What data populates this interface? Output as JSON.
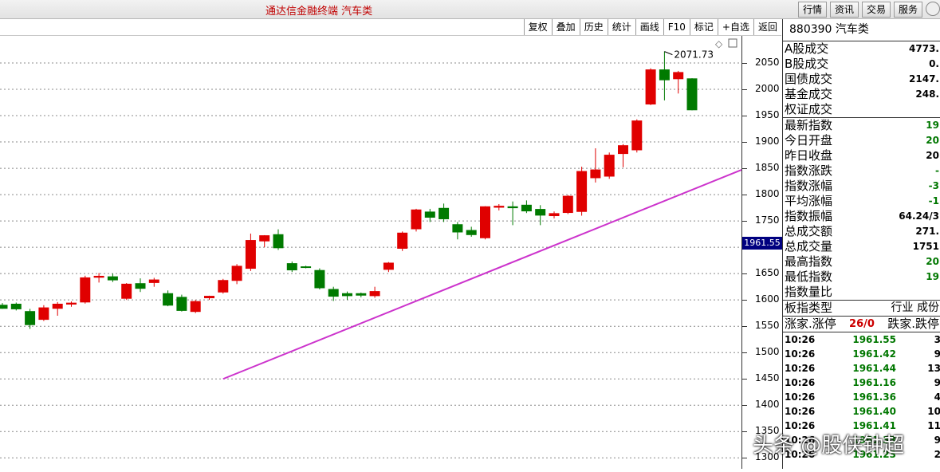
{
  "app": {
    "title": "通达信金融终端  汽车类"
  },
  "top_menu": [
    "行情",
    "资讯",
    "交易",
    "服务"
  ],
  "toolbar": [
    "复权",
    "叠加",
    "历史",
    "统计",
    "画线",
    "F10",
    "标记",
    "+自选",
    "返回"
  ],
  "chart_data": {
    "type": "candlestick",
    "ylim": [
      1300,
      2100
    ],
    "yticks": [
      1300,
      1350,
      1400,
      1450,
      1500,
      1550,
      1600,
      1650,
      1700,
      1750,
      1800,
      1850,
      1900,
      1950,
      2000,
      2050
    ],
    "ytick_labels": [
      "1300",
      "1350",
      "1400",
      "1450",
      "1500",
      "1550",
      "1600",
      "1650",
      "",
      "1750",
      "1800",
      "1850",
      "1900",
      "1950",
      "2000",
      "2050"
    ],
    "current_price_label": "1961.55",
    "high_annotation": {
      "value": 2071.73,
      "label": "2071.73"
    },
    "trendline": {
      "from": [
        16,
        1450
      ],
      "to": [
        60,
        1905
      ]
    },
    "candles": [
      {
        "o": 1590,
        "h": 1594,
        "l": 1583,
        "c": 1584
      },
      {
        "o": 1592,
        "h": 1595,
        "l": 1580,
        "c": 1583
      },
      {
        "o": 1578,
        "h": 1583,
        "l": 1545,
        "c": 1553
      },
      {
        "o": 1563,
        "h": 1590,
        "l": 1560,
        "c": 1585
      },
      {
        "o": 1584,
        "h": 1596,
        "l": 1570,
        "c": 1592
      },
      {
        "o": 1592,
        "h": 1597,
        "l": 1587,
        "c": 1594
      },
      {
        "o": 1596,
        "h": 1646,
        "l": 1593,
        "c": 1642
      },
      {
        "o": 1643,
        "h": 1651,
        "l": 1633,
        "c": 1645
      },
      {
        "o": 1644,
        "h": 1650,
        "l": 1634,
        "c": 1638
      },
      {
        "o": 1603,
        "h": 1632,
        "l": 1600,
        "c": 1630
      },
      {
        "o": 1631,
        "h": 1641,
        "l": 1615,
        "c": 1622
      },
      {
        "o": 1633,
        "h": 1642,
        "l": 1625,
        "c": 1638
      },
      {
        "o": 1612,
        "h": 1618,
        "l": 1588,
        "c": 1590
      },
      {
        "o": 1605,
        "h": 1610,
        "l": 1578,
        "c": 1580
      },
      {
        "o": 1578,
        "h": 1600,
        "l": 1575,
        "c": 1597
      },
      {
        "o": 1604,
        "h": 1608,
        "l": 1600,
        "c": 1607
      },
      {
        "o": 1615,
        "h": 1640,
        "l": 1612,
        "c": 1637
      },
      {
        "o": 1637,
        "h": 1668,
        "l": 1630,
        "c": 1664
      },
      {
        "o": 1660,
        "h": 1726,
        "l": 1655,
        "c": 1713
      },
      {
        "o": 1712,
        "h": 1723,
        "l": 1700,
        "c": 1722
      },
      {
        "o": 1724,
        "h": 1734,
        "l": 1695,
        "c": 1699
      },
      {
        "o": 1669,
        "h": 1673,
        "l": 1653,
        "c": 1657
      },
      {
        "o": 1663,
        "h": 1665,
        "l": 1660,
        "c": 1662
      },
      {
        "o": 1656,
        "h": 1660,
        "l": 1620,
        "c": 1623
      },
      {
        "o": 1620,
        "h": 1625,
        "l": 1598,
        "c": 1607
      },
      {
        "o": 1612,
        "h": 1616,
        "l": 1600,
        "c": 1608
      },
      {
        "o": 1612,
        "h": 1614,
        "l": 1605,
        "c": 1609
      },
      {
        "o": 1608,
        "h": 1625,
        "l": 1604,
        "c": 1616
      },
      {
        "o": 1658,
        "h": 1672,
        "l": 1653,
        "c": 1670
      },
      {
        "o": 1698,
        "h": 1730,
        "l": 1693,
        "c": 1727
      },
      {
        "o": 1735,
        "h": 1773,
        "l": 1730,
        "c": 1771
      },
      {
        "o": 1767,
        "h": 1773,
        "l": 1748,
        "c": 1757
      },
      {
        "o": 1774,
        "h": 1783,
        "l": 1748,
        "c": 1754
      },
      {
        "o": 1743,
        "h": 1748,
        "l": 1715,
        "c": 1729
      },
      {
        "o": 1732,
        "h": 1739,
        "l": 1720,
        "c": 1724
      },
      {
        "o": 1718,
        "h": 1778,
        "l": 1715,
        "c": 1777
      },
      {
        "o": 1776,
        "h": 1782,
        "l": 1770,
        "c": 1778
      },
      {
        "o": 1777,
        "h": 1787,
        "l": 1742,
        "c": 1775
      },
      {
        "o": 1780,
        "h": 1789,
        "l": 1765,
        "c": 1769
      },
      {
        "o": 1772,
        "h": 1780,
        "l": 1742,
        "c": 1761
      },
      {
        "o": 1760,
        "h": 1768,
        "l": 1755,
        "c": 1764
      },
      {
        "o": 1766,
        "h": 1799,
        "l": 1763,
        "c": 1797
      },
      {
        "o": 1768,
        "h": 1853,
        "l": 1760,
        "c": 1844
      },
      {
        "o": 1832,
        "h": 1888,
        "l": 1823,
        "c": 1847
      },
      {
        "o": 1835,
        "h": 1880,
        "l": 1830,
        "c": 1875
      },
      {
        "o": 1878,
        "h": 1896,
        "l": 1852,
        "c": 1893
      },
      {
        "o": 1885,
        "h": 1943,
        "l": 1880,
        "c": 1940
      },
      {
        "o": 1972,
        "h": 2040,
        "l": 1970,
        "c": 2037
      },
      {
        "o": 2037,
        "h": 2072,
        "l": 1979,
        "c": 2018
      },
      {
        "o": 2020,
        "h": 2035,
        "l": 1992,
        "c": 2032
      },
      {
        "o": 2020,
        "h": 2021,
        "l": 1960,
        "c": 1961
      }
    ]
  },
  "panel": {
    "header": "880390 汽车类",
    "stats": [
      {
        "label": "A股成交",
        "value": "4773.",
        "color": "#000000"
      },
      {
        "label": "B股成交",
        "value": "0.",
        "color": "#000000"
      },
      {
        "label": "国债成交",
        "value": "2147.",
        "color": "#000000"
      },
      {
        "label": "基金成交",
        "value": "248.",
        "color": "#000000"
      },
      {
        "label": "权证成交",
        "value": "",
        "color": "#000000"
      }
    ],
    "index_stats": [
      {
        "label": "最新指数",
        "value": "19",
        "color": "#007700"
      },
      {
        "label": "今日开盘",
        "value": "20",
        "color": "#007700"
      },
      {
        "label": "昨日收盘",
        "value": "20",
        "color": "#000000"
      },
      {
        "label": "指数涨跌",
        "value": "-",
        "color": "#007700"
      },
      {
        "label": "指数涨幅",
        "value": "-3",
        "color": "#007700"
      },
      {
        "label": "平均涨幅",
        "value": "-1",
        "color": "#007700"
      },
      {
        "label": "指数振幅",
        "value": "64.24/3",
        "color": "#000000"
      },
      {
        "label": "总成交额",
        "value": "271.",
        "color": "#000000"
      },
      {
        "label": "总成交量",
        "value": "1751",
        "color": "#000000"
      },
      {
        "label": "最高指数",
        "value": "20",
        "color": "#007700"
      },
      {
        "label": "最低指数",
        "value": "19",
        "color": "#007700"
      },
      {
        "label": "指数量比",
        "value": "",
        "color": "#000000"
      }
    ],
    "type_row": {
      "label": "板指类型",
      "value": "行业 成份"
    },
    "limit_row": {
      "label1": "涨家.涨停",
      "value": "26/0",
      "label2": "跌家.跌停"
    },
    "ticks": [
      {
        "time": "10:26",
        "price": "1961.55",
        "vol": "3"
      },
      {
        "time": "10:26",
        "price": "1961.42",
        "vol": "9"
      },
      {
        "time": "10:26",
        "price": "1961.44",
        "vol": "13"
      },
      {
        "time": "10:26",
        "price": "1961.16",
        "vol": "9"
      },
      {
        "time": "10:26",
        "price": "1961.36",
        "vol": "4"
      },
      {
        "time": "10:26",
        "price": "1961.40",
        "vol": "10"
      },
      {
        "time": "10:26",
        "price": "1961.41",
        "vol": "11"
      },
      {
        "time": "10:26",
        "price": "1961.33",
        "vol": "9"
      },
      {
        "time": "10:26",
        "price": "1961.23",
        "vol": "2"
      }
    ]
  },
  "watermark": "头条 @股侠钟超"
}
